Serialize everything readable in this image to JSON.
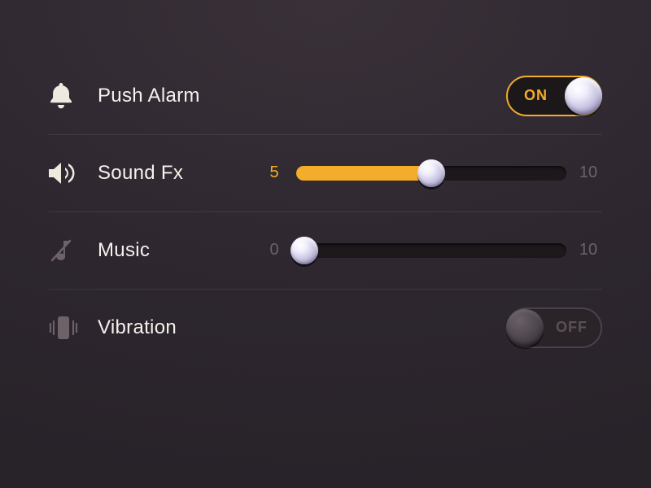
{
  "settings": {
    "push_alarm": {
      "label": "Push Alarm",
      "state_label": "ON",
      "on": true
    },
    "sound_fx": {
      "label": "Sound Fx",
      "value": 5,
      "min_label": "5",
      "max_label": "10",
      "percent": 50
    },
    "music": {
      "label": "Music",
      "value": 0,
      "min_label": "0",
      "max_label": "10",
      "percent": 3
    },
    "vibration": {
      "label": "Vibration",
      "state_label": "OFF",
      "on": false
    }
  },
  "colors": {
    "accent": "#f3ad2a"
  }
}
